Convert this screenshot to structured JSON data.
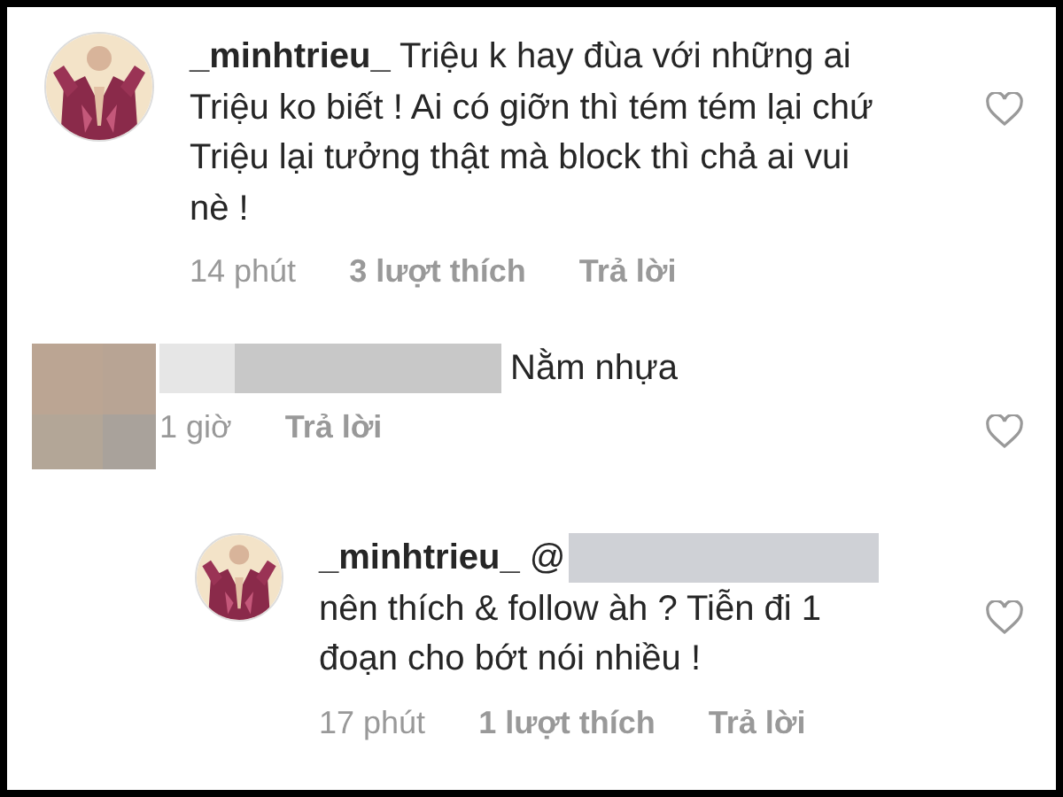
{
  "comments": [
    {
      "body": "**_minhtrieu_** Triệu k hay đùa với những ai Triệu ko biết ! Ai có giỡn thì tém tém lại chứ Triệu lại tưởng thật mà block thì chả ai vui nè !",
      "time": "14 phút",
      "likes": "3 lượt thích",
      "reply": "Trả lời"
    },
    {
      "avatar": {
        "kind": "blurred"
      },
      "redacted_name": true,
      "body": "Nằm nhựa",
      "time": "1 giờ",
      "reply": "Trả lời",
      "replies": [
        {
          "head": "**_minhtrieu_** @",
          "redacted_name": true,
          "body": "nên thích & follow àh ? Tiễn đi 1 đoạn cho bớt nói nhiều !",
          "time": "17 phút",
          "likes": "1 lượt thích",
          "reply": "Trả lời"
        }
      ]
    }
  ]
}
